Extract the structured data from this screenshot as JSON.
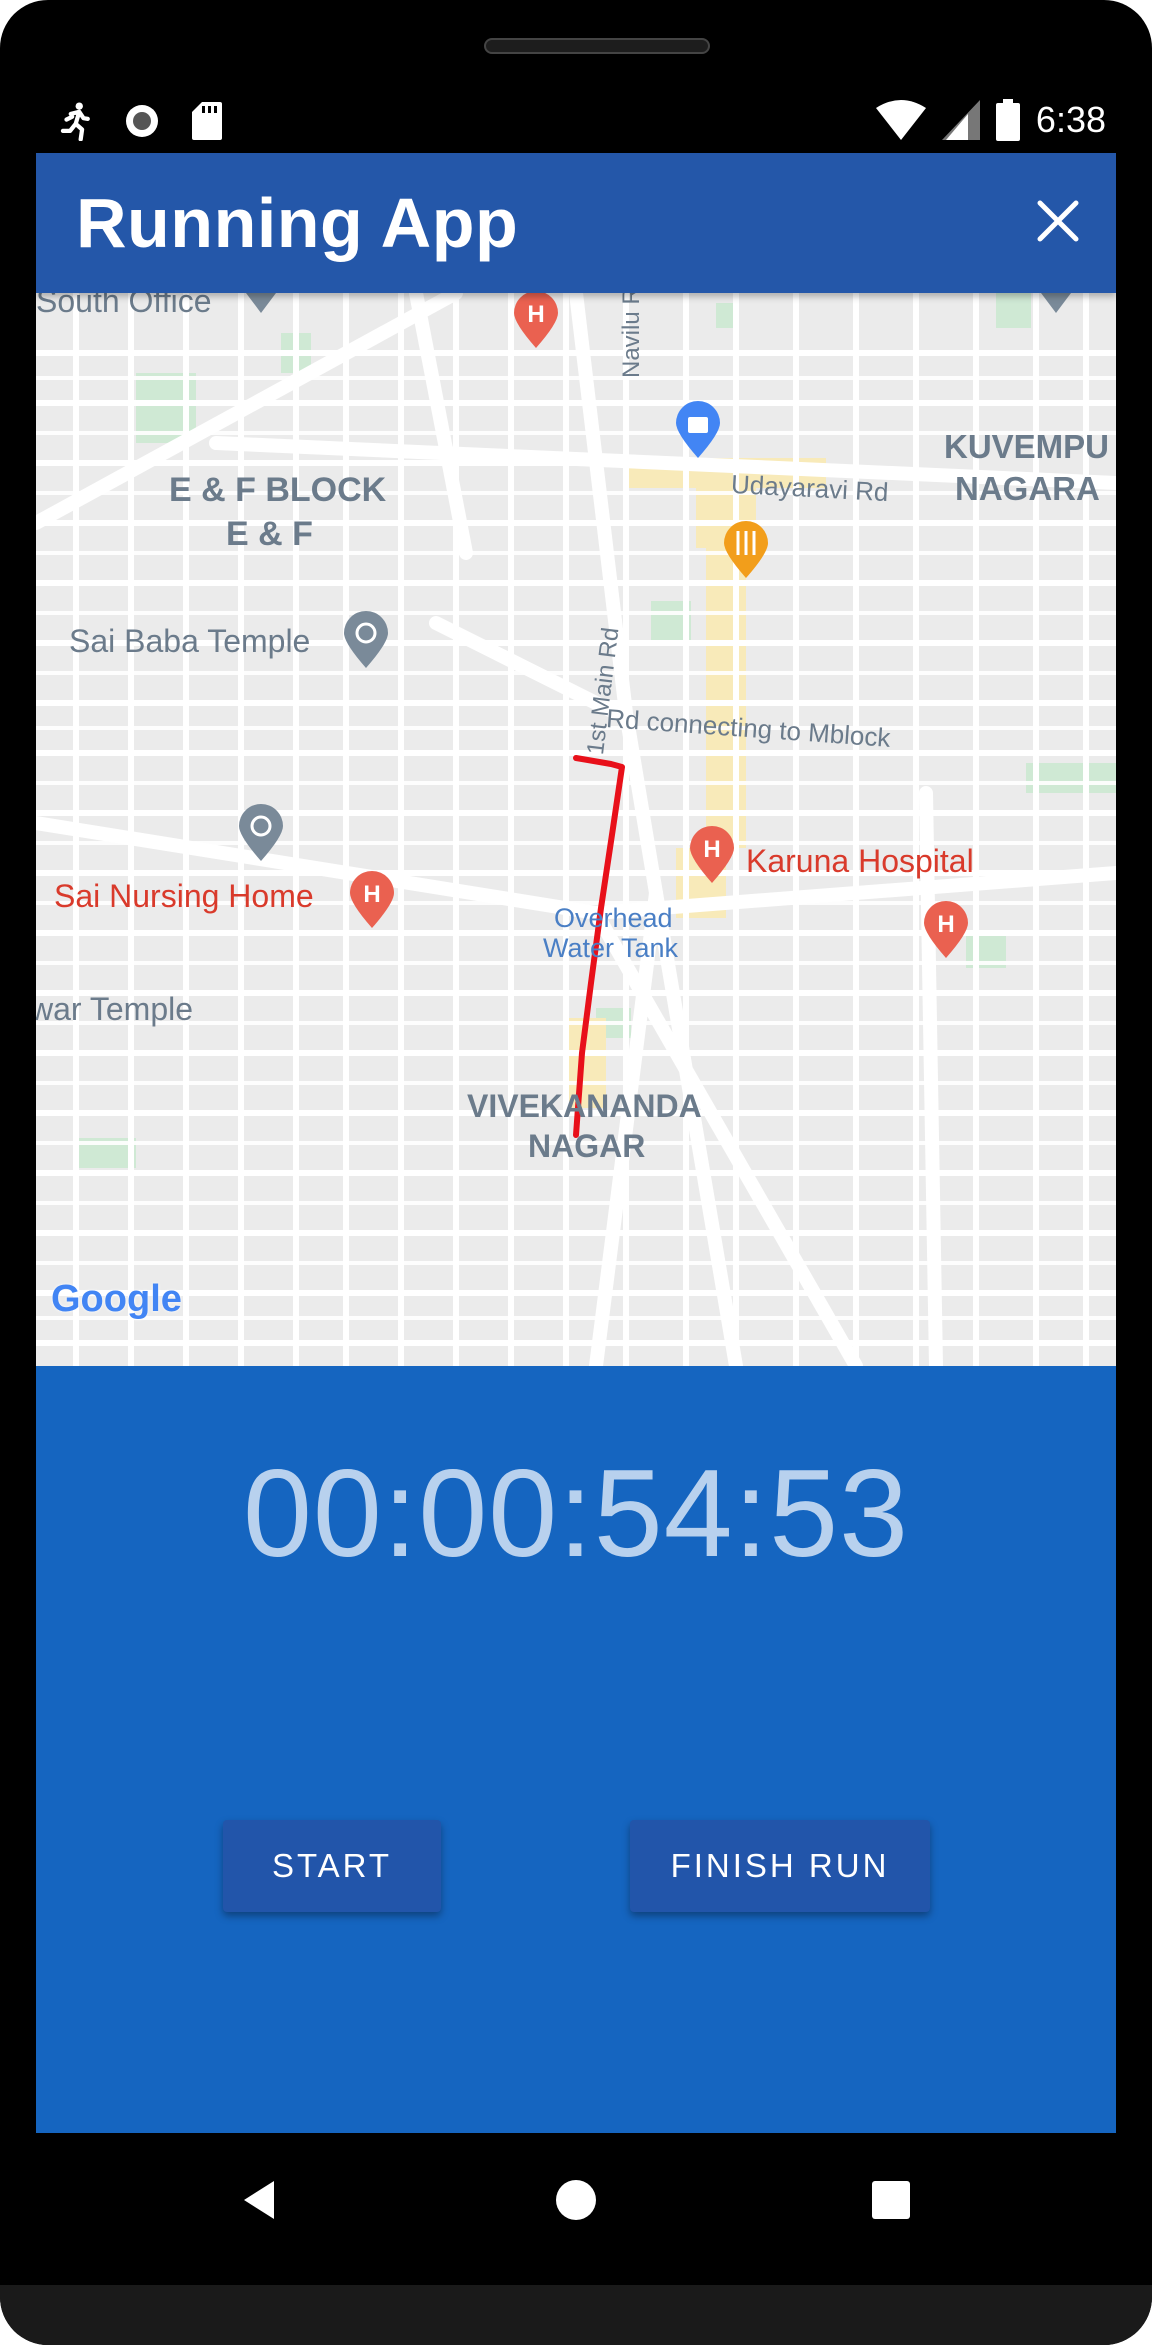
{
  "status_bar": {
    "time": "6:38",
    "left_icons": [
      "running-icon",
      "record-icon",
      "sdcard-icon"
    ],
    "right_icons": [
      "wifi-icon",
      "signal-icon",
      "battery-icon"
    ]
  },
  "app_bar": {
    "title": "Running App",
    "close_icon": "close-icon",
    "color": "#2457a9"
  },
  "map": {
    "labels": [
      {
        "id": "south-office",
        "text": "South Office"
      },
      {
        "id": "ef-block",
        "text": "E & F BLOCK"
      },
      {
        "id": "ef",
        "text": "E & F"
      },
      {
        "id": "navilu-rd",
        "text": "Navilu Rd"
      },
      {
        "id": "udayaravi-rd",
        "text": "Udayaravi Rd"
      },
      {
        "id": "kuvempu",
        "text": "KUVEMPU"
      },
      {
        "id": "nagara",
        "text": "NAGARA"
      },
      {
        "id": "first-main-rd",
        "text": "1st Main Rd"
      },
      {
        "id": "rd-connecting",
        "text": "Rd connecting to Mblock"
      },
      {
        "id": "sai-baba-temple",
        "text": "Sai Baba Temple"
      },
      {
        "id": "karuna-hospital",
        "text": "Karuna Hospital"
      },
      {
        "id": "sai-nursing-home",
        "text": "Sai Nursing Home"
      },
      {
        "id": "overhead",
        "text": "Overhead"
      },
      {
        "id": "water-tank",
        "text": "Water Tank"
      },
      {
        "id": "war-temple",
        "text": "war Temple"
      },
      {
        "id": "vivekananda",
        "text": "VIVEKANANDA"
      },
      {
        "id": "nagar",
        "text": "NAGAR"
      },
      {
        "id": "google",
        "text": "Google"
      }
    ],
    "route_color": "#e8101a"
  },
  "timer": {
    "value": "00:00:54:53"
  },
  "buttons": {
    "start": "START",
    "finish": "FINISH RUN"
  },
  "colors": {
    "screen_bg": "#1565c0",
    "button_bg": "#2255aa",
    "timer_text": "#b8d1ee"
  }
}
